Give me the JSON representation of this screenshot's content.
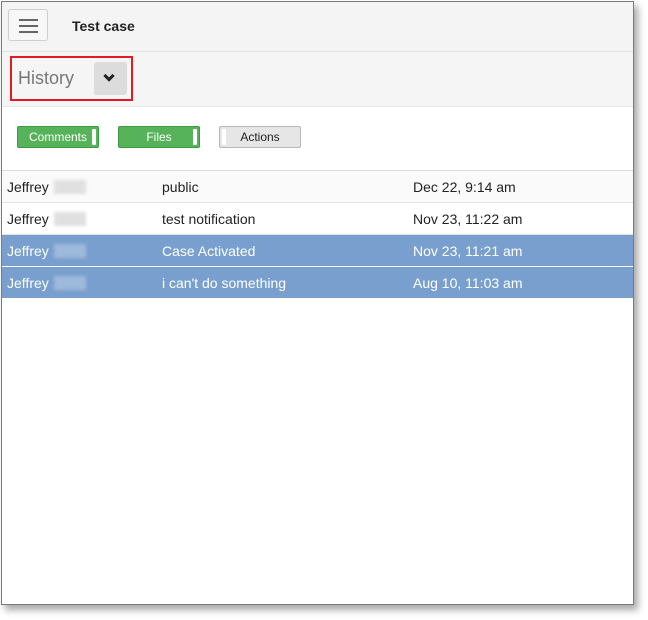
{
  "header": {
    "title": "Test case"
  },
  "history": {
    "label": "History"
  },
  "filters": [
    {
      "label": "Comments",
      "state": "on"
    },
    {
      "label": "Files",
      "state": "on"
    },
    {
      "label": "Actions",
      "state": "off"
    }
  ],
  "rows": [
    {
      "user": "Jeffrey",
      "description": "public",
      "date": "Dec 22, 9:14 am",
      "selected": false
    },
    {
      "user": "Jeffrey",
      "description": "test notification",
      "date": "Nov 23, 11:22 am",
      "selected": false
    },
    {
      "user": "Jeffrey",
      "description": "Case Activated",
      "date": "Nov 23, 11:21 am",
      "selected": true
    },
    {
      "user": "Jeffrey",
      "description": "i can't do something",
      "date": "Aug 10, 11:03 am",
      "selected": true
    }
  ],
  "colors": {
    "toggle_on": "#56b35a",
    "selected_row": "#789fcd",
    "highlight_border": "#e01b22"
  }
}
